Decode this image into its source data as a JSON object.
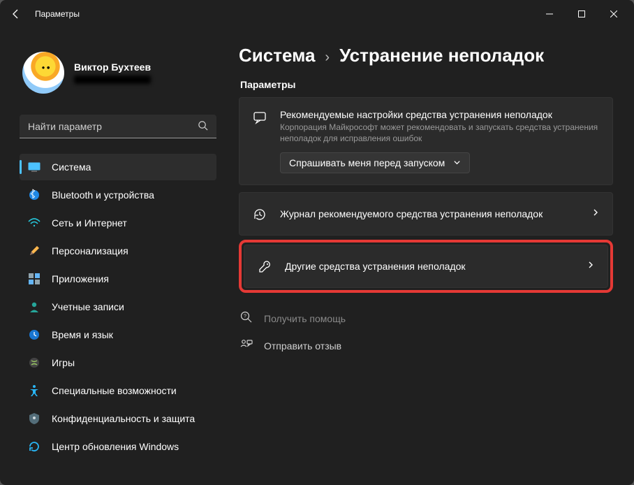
{
  "window": {
    "title": "Параметры"
  },
  "profile": {
    "name": "Виктор Бухтеев"
  },
  "search": {
    "placeholder": "Найти параметр"
  },
  "nav": [
    {
      "label": "Система"
    },
    {
      "label": "Bluetooth и устройства"
    },
    {
      "label": "Сеть и Интернет"
    },
    {
      "label": "Персонализация"
    },
    {
      "label": "Приложения"
    },
    {
      "label": "Учетные записи"
    },
    {
      "label": "Время и язык"
    },
    {
      "label": "Игры"
    },
    {
      "label": "Специальные возможности"
    },
    {
      "label": "Конфиденциальность и защита"
    },
    {
      "label": "Центр обновления Windows"
    }
  ],
  "breadcrumb": {
    "root": "Система",
    "sep": "›",
    "leaf": "Устранение неполадок"
  },
  "section": {
    "label": "Параметры"
  },
  "reco": {
    "title": "Рекомендуемые настройки средства устранения неполадок",
    "desc": "Корпорация Майкрософт может рекомендовать и запускать средства устранения неполадок для исправления ошибок",
    "dropdown": "Спрашивать меня перед запуском"
  },
  "rows": [
    {
      "label": "Журнал рекомендуемого средства устранения неполадок"
    },
    {
      "label": "Другие средства устранения неполадок"
    }
  ],
  "footer": [
    {
      "label": "Получить помощь"
    },
    {
      "label": "Отправить отзыв"
    }
  ]
}
